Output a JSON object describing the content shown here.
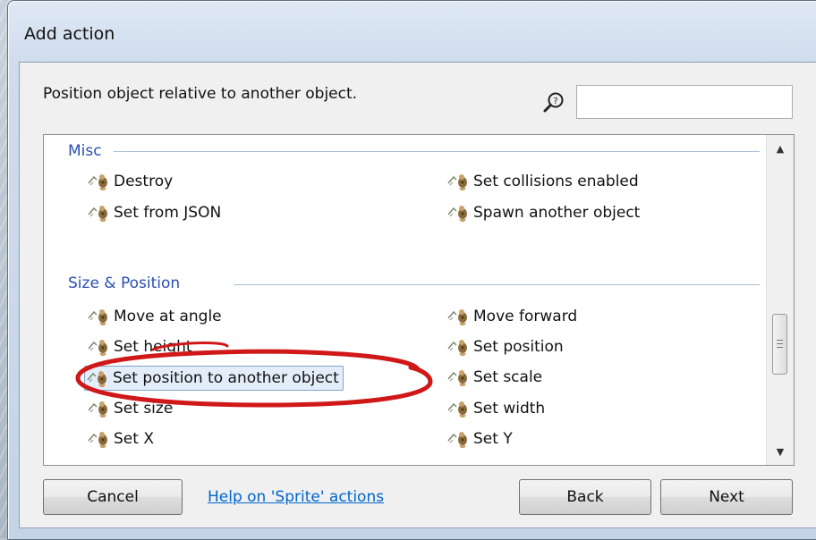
{
  "window": {
    "title": "Add action"
  },
  "description": "Position object relative to another object.",
  "search": {
    "value": "",
    "placeholder": ""
  },
  "icons": {
    "search": "search-icon",
    "action": "sprite-icon"
  },
  "sections": [
    {
      "title": "Misc",
      "actions": [
        {
          "label": "Destroy"
        },
        {
          "label": "Set collisions enabled"
        },
        {
          "label": "Set from JSON"
        },
        {
          "label": "Spawn another object"
        }
      ]
    },
    {
      "title": "Size & Position",
      "actions": [
        {
          "label": "Move at angle"
        },
        {
          "label": "Move forward"
        },
        {
          "label": "Set height"
        },
        {
          "label": "Set position"
        },
        {
          "label": "Set position to another object",
          "selected": true
        },
        {
          "label": "Set scale"
        },
        {
          "label": "Set size"
        },
        {
          "label": "Set width"
        },
        {
          "label": "Set X"
        },
        {
          "label": "Set Y"
        }
      ]
    }
  ],
  "buttons": {
    "cancel": "Cancel",
    "back": "Back",
    "next": "Next"
  },
  "help_link": "Help on 'Sprite' actions",
  "colors": {
    "section_header": "#2a4fb3",
    "link": "#0066cc",
    "highlight_ellipse": "#d01818",
    "selection_bg": "#e4eefb"
  }
}
